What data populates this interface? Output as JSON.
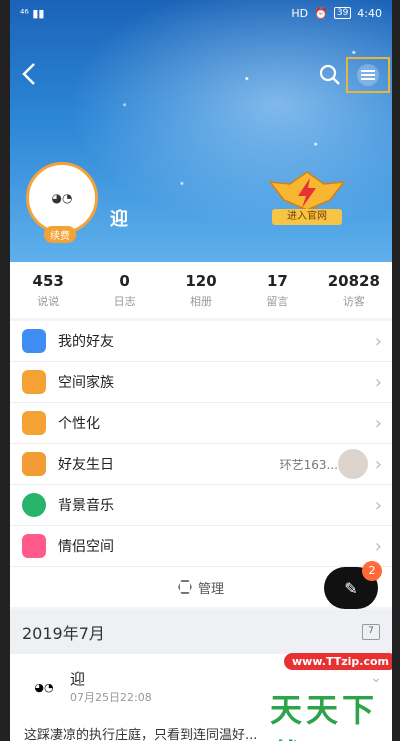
{
  "status": {
    "signal": "⁴⁶ ▮▮",
    "time": "4:40",
    "battery": "39",
    "hd": "HD"
  },
  "profile": {
    "name": "迎",
    "vip_tag": "续费",
    "badge_label": "进入官网"
  },
  "stats": [
    {
      "value": "453",
      "label": "说说"
    },
    {
      "value": "0",
      "label": "日志"
    },
    {
      "value": "120",
      "label": "相册"
    },
    {
      "value": "17",
      "label": "留言"
    },
    {
      "value": "20828",
      "label": "访客"
    }
  ],
  "menu": [
    {
      "label": "我的好友",
      "color": "#3f8df3"
    },
    {
      "label": "空间家族",
      "color": "#f3a233"
    },
    {
      "label": "个性化",
      "color": "#f3a233"
    },
    {
      "label": "好友生日",
      "color": "#f39c33",
      "extra": "环艺163..."
    },
    {
      "label": "背景音乐",
      "color": "#27b36a"
    },
    {
      "label": "情侣空间",
      "color": "#ff5a8a"
    }
  ],
  "manage_label": "管理",
  "fab_badge": "2",
  "month": "2019年7月",
  "calendar_num": "7",
  "feed": {
    "name": "迎",
    "time": "07月25日22:08",
    "text": "这踩凄凉的执行庄庭，只看到连同温好..."
  },
  "watermark": {
    "url": "www.TTzip.com",
    "text": "天天下载"
  }
}
